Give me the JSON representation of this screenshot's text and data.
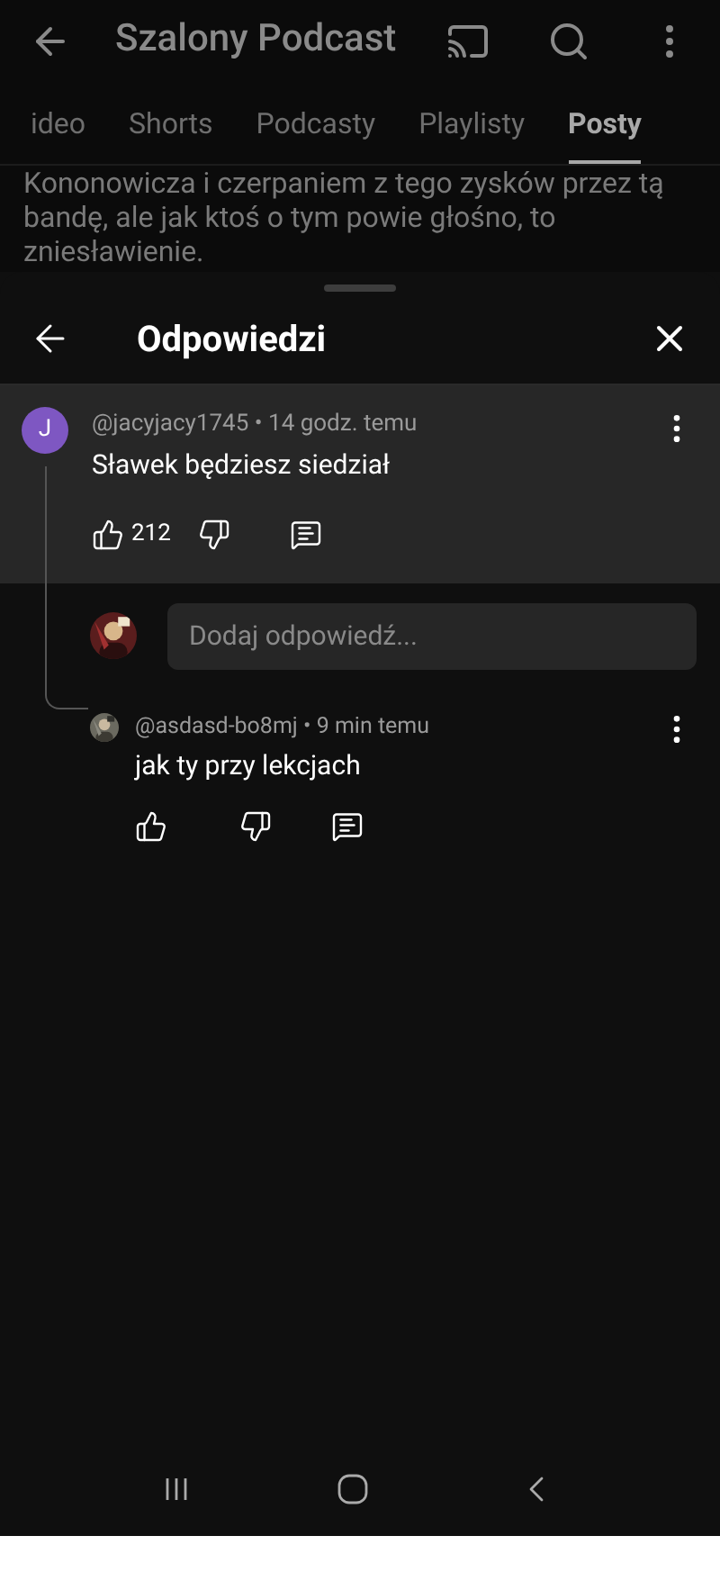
{
  "header": {
    "title": "Szalony Podcast"
  },
  "tabs": [
    {
      "label": "ideo",
      "selected": false
    },
    {
      "label": "Shorts",
      "selected": false
    },
    {
      "label": "Podcasty",
      "selected": false
    },
    {
      "label": "Playlisty",
      "selected": false
    },
    {
      "label": "Posty",
      "selected": true
    }
  ],
  "post_text": "Kononowicza i czerpaniem z tego zysków przez tą bandę, ale jak ktoś o tym powie głośno, to zniesławienie.",
  "sheet": {
    "title": "Odpowiedzi"
  },
  "comment": {
    "avatar": {
      "letter": "J",
      "color": "#7e57c2"
    },
    "meta": "@jacyjacy1745 • 14 godz. temu",
    "text": "Sławek będziesz siedział",
    "likes": "212"
  },
  "reply_field": {
    "placeholder": "Dodaj odpowiedź..."
  },
  "replies": [
    {
      "meta": "@asdasd-bo8mj • 9 min temu",
      "text": "jak ty przy lekcjach"
    }
  ]
}
